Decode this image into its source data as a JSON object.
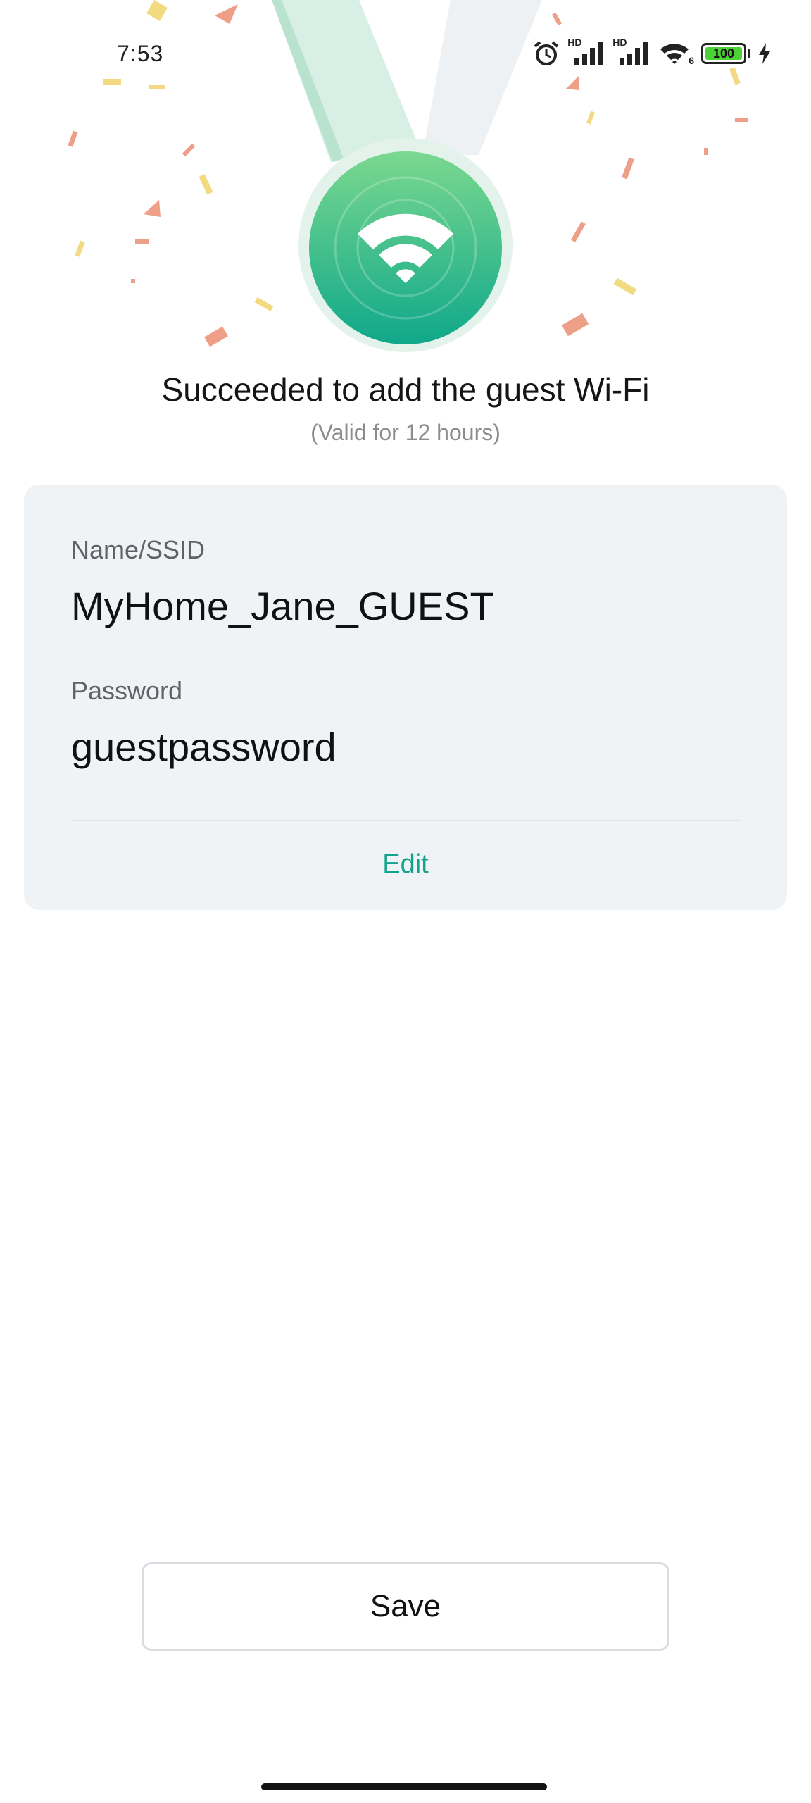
{
  "status_bar": {
    "time": "7:53",
    "hd_label_1": "HD",
    "hd_label_2": "HD",
    "wifi_badge": "6",
    "battery_level": "100",
    "icons": [
      "alarm-icon",
      "signal-icon",
      "signal-icon",
      "wifi-icon",
      "battery-icon",
      "charging-icon"
    ]
  },
  "hero": {
    "icon": "wifi-icon",
    "colors": {
      "medal_top": "#7bd88f",
      "medal_bottom": "#0fa88a",
      "ribbon": "#d7efe5",
      "ribbon_alt": "#eef1f4"
    }
  },
  "result": {
    "title": "Succeeded to add the guest Wi-Fi",
    "subtitle": "(Valid for 12 hours)"
  },
  "credentials": {
    "ssid_label": "Name/SSID",
    "ssid_value": "MyHome_Jane_GUEST",
    "password_label": "Password",
    "password_value": "guestpassword",
    "edit_label": "Edit"
  },
  "actions": {
    "save_label": "Save"
  },
  "colors": {
    "accent": "#11a38c",
    "card_bg": "#f0f3f6"
  }
}
